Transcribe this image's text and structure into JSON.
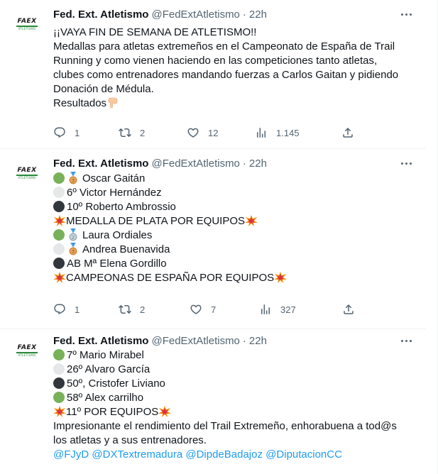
{
  "tweets": [
    {
      "author": {
        "name": "Fed. Ext. Atletismo",
        "handle": "@FedExtAtletismo",
        "time": "22h",
        "avatar_text": "FAEX",
        "avatar_sub": "ATLETISMO"
      },
      "lines": [
        "¡¡VAYA FIN DE SEMANA DE ATLETISMO!!",
        "Medallas para atletas extremeños en el Campeonato de España de Trail",
        "Running y como vienen haciendo en las competiciones tanto atletas,",
        "clubes como entrenadores mandando fuerzas a Carlos Gaitan y pidiendo",
        "Donación de Médula.",
        "Resultados"
      ],
      "stats": {
        "replies": "1",
        "retweets": "2",
        "likes": "12",
        "views": "1.145"
      }
    },
    {
      "author": {
        "name": "Fed. Ext. Atletismo",
        "handle": "@FedExtAtletismo",
        "time": "22h",
        "avatar_text": "FAEX",
        "avatar_sub": "ATLETISMO"
      },
      "lines": [
        "Oscar Gaitán",
        "6º Victor Hernández",
        "10º Roberto Ambrossio",
        "MEDALLA DE PLATA POR EQUIPOS",
        "Laura Ordiales",
        "Andrea Buenavida",
        "AB Mª Elena Gordillo",
        "CAMPEONAS DE ESPAÑA POR EQUIPOS"
      ],
      "stats": {
        "replies": "1",
        "retweets": "2",
        "likes": "7",
        "views": "327"
      }
    },
    {
      "author": {
        "name": "Fed. Ext. Atletismo",
        "handle": "@FedExtAtletismo",
        "time": "22h",
        "avatar_text": "FAEX",
        "avatar_sub": "ATLETISMO"
      },
      "lines": [
        "7º Mario Mirabel",
        "26º Alvaro García",
        "50º, Cristofer Liviano",
        "58º Alex carrilho",
        "11º POR EQUIPOS",
        "Impresionante el rendimiento del Trail Extremeño, enhorabuena a tod@s",
        "los atletas y a sus entrenadores."
      ],
      "mentions": [
        "@FJyD",
        "@DXTextremadura",
        "@DipdeBadajoz",
        "@DiputacionCC"
      ]
    }
  ],
  "colors": {
    "link": "#1d9bf0",
    "muted": "#536471",
    "text": "#0f1419",
    "green_dot": "#78b159",
    "white_dot": "#e6e7e8",
    "black_dot": "#31373d"
  },
  "icons": {
    "reply": "reply-icon",
    "retweet": "retweet-icon",
    "like": "heart-icon",
    "views": "views-icon",
    "share": "share-icon",
    "more": "more-icon"
  }
}
